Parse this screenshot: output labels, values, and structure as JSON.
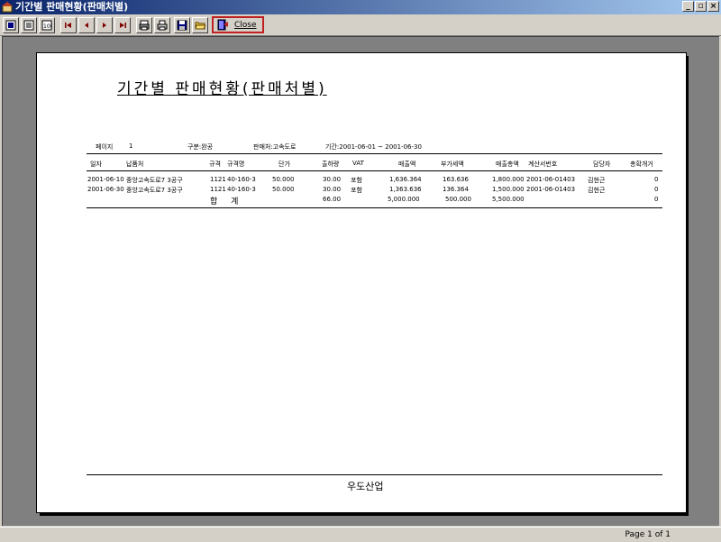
{
  "window": {
    "title": "기간별 판매현황(판매처별)",
    "controls": [
      "_",
      "▫",
      "×"
    ]
  },
  "toolbar": {
    "close_label": "Close"
  },
  "report": {
    "title": "기간별 판매현황(판매처별)",
    "page_label": "페이지",
    "page_value": "1",
    "division": "구분:완공",
    "seller": "판매처:고속도로",
    "period": "기간:2001-06-01 ~ 2001-06-30",
    "columns": [
      "일자",
      "납품처",
      "규격",
      "규격명",
      "단가",
      "출하량",
      "VAT",
      "매출액",
      "부가세액",
      "매출총액",
      "계산서번호",
      "담당자",
      "총확개거"
    ],
    "rows": [
      [
        "2001-06-10",
        "중앙고속도로7 3공구",
        "1121",
        "40-160-3",
        "50.000",
        "30.00",
        "포함",
        "1,636.364",
        "163.636",
        "1,800.000",
        "2001-06-01403",
        "김현근",
        "0"
      ],
      [
        "2001-06-30",
        "중앙고속도로7 3공구",
        "1121",
        "40-160-3",
        "50.000",
        "30.00",
        "포함",
        "1,363.636",
        "136.364",
        "1,500.000",
        "2001-06-01403",
        "김현근",
        "0"
      ]
    ],
    "totals": {
      "label": "합 계",
      "qty": "66.00",
      "sales": "5,000.000",
      "vat": "500.000",
      "total": "5,500.000",
      "last": "0"
    },
    "footer_company": "우도산업"
  },
  "status": {
    "page_info": "Page 1 of 1"
  }
}
